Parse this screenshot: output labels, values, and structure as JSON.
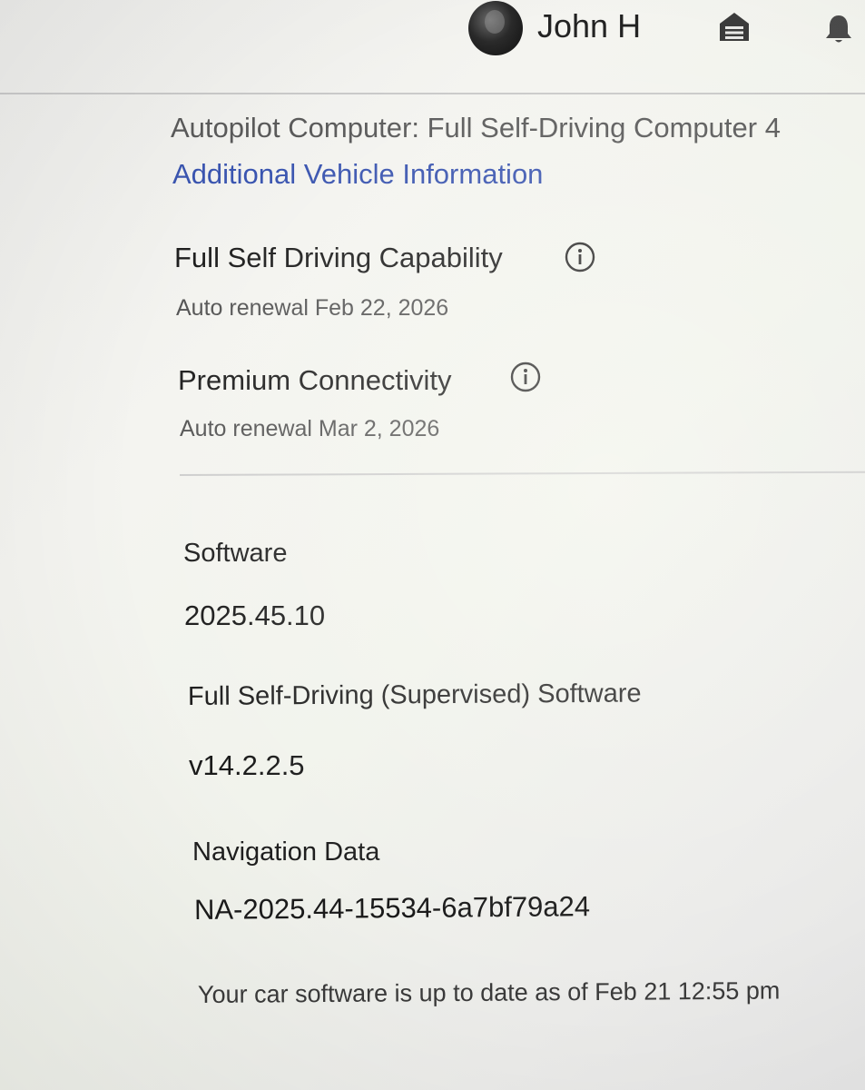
{
  "header": {
    "user_name": "John H",
    "avatar_icon": "user-avatar",
    "garage_icon": "garage-icon",
    "notifications_icon": "bell-icon"
  },
  "vehicle": {
    "autopilot_computer": "Autopilot Computer: Full Self-Driving Computer 4",
    "additional_info_link": "Additional Vehicle Information",
    "link_color": "#3a55b0"
  },
  "features": [
    {
      "name": "Full Self Driving Capability",
      "renewal": "Auto renewal Feb 22, 2026",
      "icon": "info-icon"
    },
    {
      "name": "Premium Connectivity",
      "renewal": "Auto renewal Mar 2, 2026",
      "icon": "info-icon"
    }
  ],
  "software": {
    "label": "Software",
    "version": "2025.45.10",
    "fsd_label": "Full Self-Driving (Supervised) Software",
    "fsd_version": "v14.2.2.5",
    "nav_label": "Navigation Data",
    "nav_version": "NA-2025.44-15534-6a7bf79a24",
    "status": "Your car software is up to date as of Feb 21 12:55 pm"
  }
}
